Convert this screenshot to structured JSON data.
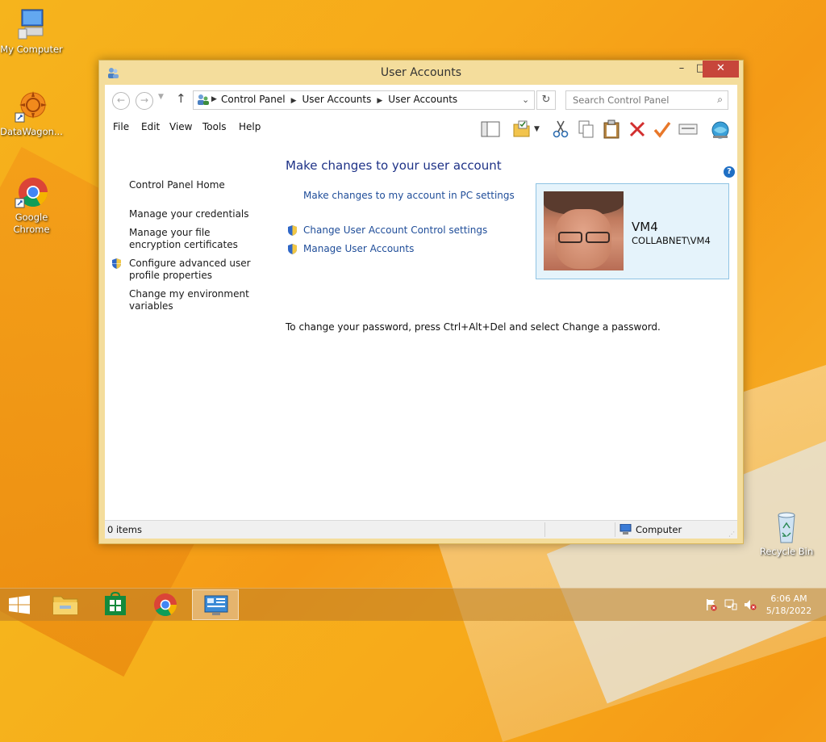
{
  "desktop": {
    "icons": [
      {
        "label": "My Computer"
      },
      {
        "label": "DataWagon..."
      },
      {
        "label": "Google Chrome"
      },
      {
        "label": "Recycle Bin"
      }
    ]
  },
  "window": {
    "title": "User Accounts",
    "controls": {
      "minimize": "–",
      "maximize": "□",
      "close": "✕"
    }
  },
  "address": {
    "breadcrumbs": [
      "Control Panel",
      "User Accounts",
      "User Accounts"
    ],
    "search_placeholder": "Search Control Panel"
  },
  "menu": {
    "items": [
      "File",
      "Edit",
      "View",
      "Tools",
      "Help"
    ]
  },
  "toolbar_icons": [
    "layout-pane-icon",
    "folder-check-icon",
    "dropdown-icon",
    "cut-icon",
    "copy-icon",
    "paste-icon",
    "delete-icon",
    "checkmark-icon",
    "properties-icon",
    "globe-icon"
  ],
  "left_pane": {
    "items": [
      {
        "label": "Control Panel Home"
      },
      {
        "label": "Manage your credentials"
      },
      {
        "label": "Manage your file encryption certificates"
      },
      {
        "label": "Configure advanced user profile properties"
      },
      {
        "label": "Change my environment variables"
      }
    ]
  },
  "main": {
    "title": "Make changes to your user account",
    "links": {
      "pc_settings": "Make changes to my account in PC settings",
      "uac": "Change User Account Control settings",
      "manage": "Manage User Accounts"
    },
    "password_note": "To change your password, press Ctrl+Alt+Del and select Change a password."
  },
  "user": {
    "name": "VM4",
    "domain": "COLLABNET\\VM4"
  },
  "status": {
    "left": "0 items",
    "right": "Computer"
  },
  "taskbar": {
    "time": "6:06 AM",
    "date": "5/18/2022"
  },
  "colors": {
    "accent_link": "#1f4d99",
    "title_blue": "#1e3287",
    "close_red": "#c7463b",
    "usercard_bg": "#e5f3fb"
  }
}
